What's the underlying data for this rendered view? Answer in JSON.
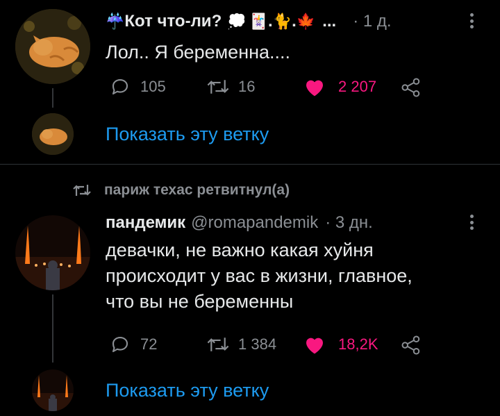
{
  "tweet1": {
    "author_name": "Кот что-ли?",
    "author_emojis": [
      "☔",
      "💭",
      "🃏",
      ".",
      "🐈",
      ".",
      "🍁",
      "..."
    ],
    "time": "· 1 д.",
    "text": "Лол.. Я беременна....",
    "replies": "105",
    "retweets": "16",
    "likes": "2 207",
    "show_thread": "Показать эту ветку",
    "like_color": "#f91880"
  },
  "retweet_notice": {
    "text": "париж техас ретвитнул(а)"
  },
  "tweet2": {
    "author_name": "пандемик",
    "handle": "@romapandemik",
    "time": "· 3 дн.",
    "text_lines": [
      "девачки, не важно какая хуйня",
      "происходит у вас в жизни, главное,",
      "что вы не беременны"
    ],
    "replies": "72",
    "retweets": "1 384",
    "likes": "18,2K",
    "show_thread": "Показать эту ветку",
    "like_color": "#f91880"
  },
  "accent_color": "#1d9bf0"
}
